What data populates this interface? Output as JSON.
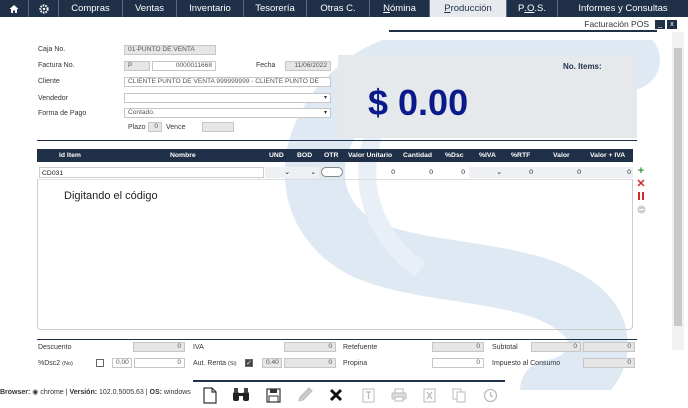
{
  "nav": {
    "tabs": [
      {
        "label": "Compras"
      },
      {
        "label": "Ventas"
      },
      {
        "label": "Inventario"
      },
      {
        "label": "Tesorería"
      },
      {
        "label": "Otras C."
      },
      {
        "label": "Nómina",
        "underline": "N",
        "rest": "ómina"
      },
      {
        "label": "Producción",
        "underline": "P",
        "rest": "roducción"
      },
      {
        "label": "P.O.S.",
        "pre": "P",
        "underline": ".O",
        "rest": ".S."
      },
      {
        "label": "Informes y Consultas"
      }
    ],
    "active_tab": "Producción"
  },
  "window": {
    "title": "Facturación POS",
    "minimize": "_",
    "close": "x"
  },
  "form": {
    "caja_label": "Caja No.",
    "caja_value": "01-PUNTO DE VENTA",
    "factura_label": "Factura No.",
    "factura_prefix": "P",
    "factura_number": "0000011668",
    "fecha_label": "Fecha",
    "fecha_value": "11/06/2022",
    "cliente_label": "Cliente",
    "cliente_value": "CLIENTE PUNTO DE VENTA 999999999 - CLIENTE PUNTO DE",
    "vendedor_label": "Vendedor",
    "vendedor_value": "",
    "forma_pago_label": "Forma de Pago",
    "forma_pago_value": "Contado.",
    "plazo_label": "Plazo",
    "plazo_value": "0",
    "vence_label": "Vence",
    "vence_value": ""
  },
  "summary": {
    "items_label": "No. Items:",
    "total": "$ 0.00"
  },
  "grid": {
    "columns": [
      "Id Item",
      "Nombre",
      "UND",
      "BOD",
      "OTR",
      "Valor Unitario",
      "Cantidad",
      "%Dsc",
      "%IVA",
      "%RTF",
      "Valor",
      "Valor + IVA"
    ],
    "row": {
      "id_item": "CD031",
      "valor_unitario": "0",
      "cantidad": "0",
      "dsc": "0",
      "rtf": "0",
      "valor": "0",
      "valor_iva": "0"
    },
    "hint": "Digitando el código"
  },
  "totals": {
    "descuento_label": "Descuento",
    "descuento_value": "0",
    "iva_label": "IVA",
    "iva_value": "0",
    "retefuente_label": "Retefuente",
    "retefuente_value": "0",
    "subtotal_label": "Subtotal",
    "subtotal_value1": "0",
    "subtotal_value2": "0",
    "dsc2_label": "%Dsc2",
    "dsc2_note": "(No)",
    "dsc2_pct": "0.00",
    "dsc2_value": "0",
    "aut_renta_label": "Aut. Renta",
    "aut_renta_note": "(Si)",
    "aut_renta_pct": "0.40",
    "aut_renta_value": "0",
    "propina_label": "Propina",
    "propina_value": "0",
    "impuesto_consumo_label": "Impuesto al Consumo",
    "impuesto_consumo_value": "0"
  },
  "footer": {
    "browser_label": "Browser:",
    "browser_value": "chrome",
    "version_label": "Versión:",
    "version_value": "102.0.5005.63",
    "os_label": "OS:",
    "os_value": "windows",
    "sep": "|"
  },
  "colors": {
    "nav": "#1f3048",
    "total": "#0b1a8a",
    "add": "#2e9b3a",
    "delete": "#d02a2a"
  }
}
